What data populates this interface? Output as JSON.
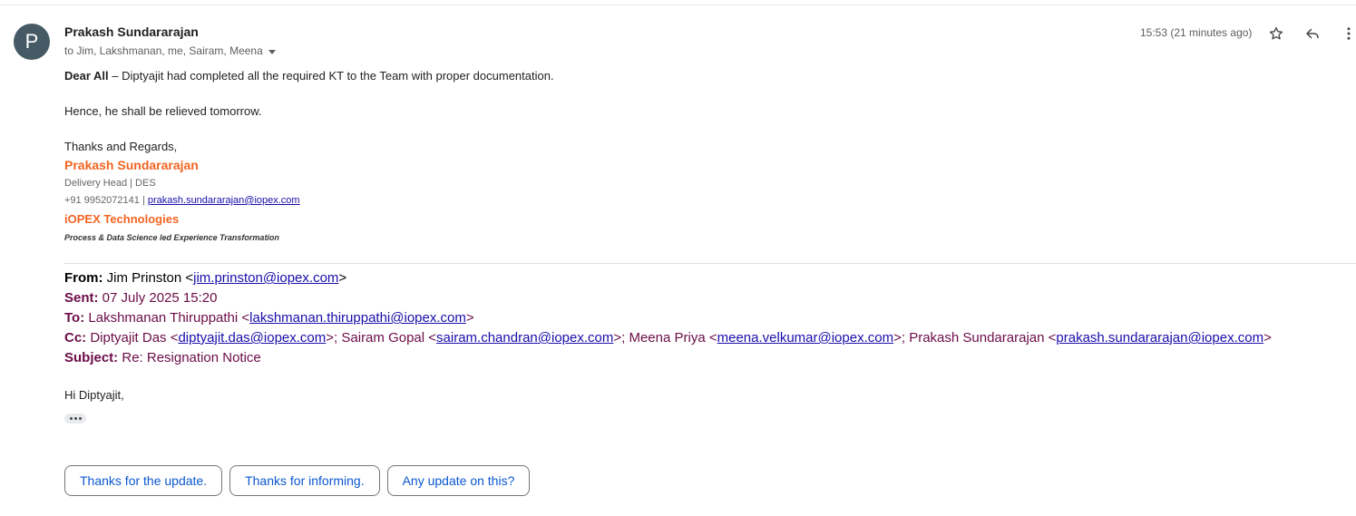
{
  "header": {
    "avatar_letter": "P",
    "avatar_color": "#455a64",
    "sender_name": "Prakash Sundararajan",
    "recipients": "to Jim, Lakshmanan, me, Sairam, Meena",
    "timestamp": "15:53 (21 minutes ago)",
    "icons": [
      "star-icon",
      "reply-icon",
      "more-vert-icon"
    ]
  },
  "body": {
    "greeting_bold": "Dear All",
    "greeting_rest": " – Diptyajit had completed all the required KT to the Team with proper documentation.",
    "line2": "Hence, he shall be relieved tomorrow.",
    "closing": "Thanks and Regards,"
  },
  "signature": {
    "name": "Prakash Sundararajan",
    "title": "Delivery Head | DES",
    "phone": "+91 9952072141 | ",
    "email": "prakash.sundararajan@iopex.com",
    "company": "iOPEX Technologies",
    "tagline": "Process & Data Science led Experience Transformation",
    "accent_color": "#f26522"
  },
  "quoted": {
    "from_label": "From:",
    "from_name": " Jim Prinston <",
    "from_email": "jim.prinston@iopex.com",
    "from_end": ">",
    "sent_label": "Sent:",
    "sent_value": " 07 July 2025 15:20",
    "to_label": "To:",
    "to_name": " Lakshmanan Thiruppathi <",
    "to_email": "lakshmanan.thiruppathi@iopex.com",
    "to_end": ">",
    "cc_label": "Cc:",
    "cc": [
      {
        "pre": " Diptyajit Das <",
        "email": "diptyajit.das@iopex.com",
        "post": ">;"
      },
      {
        "pre": " Sairam Gopal <",
        "email": "sairam.chandran@iopex.com",
        "post": ">;"
      },
      {
        "pre": " Meena Priya <",
        "email": "meena.velkumar@iopex.com",
        "post": ">;"
      },
      {
        "pre": " Prakash Sundararajan <",
        "email": "prakash.sundararajan@iopex.com",
        "post": ">"
      }
    ],
    "subject_label": "Subject:",
    "subject_value": " Re: Resignation Notice",
    "greeting": "Hi Diptyajit,",
    "label_color": "#6b0d47"
  },
  "smart_replies": [
    "Thanks for the update.",
    "Thanks for informing.",
    "Any update on this?"
  ]
}
